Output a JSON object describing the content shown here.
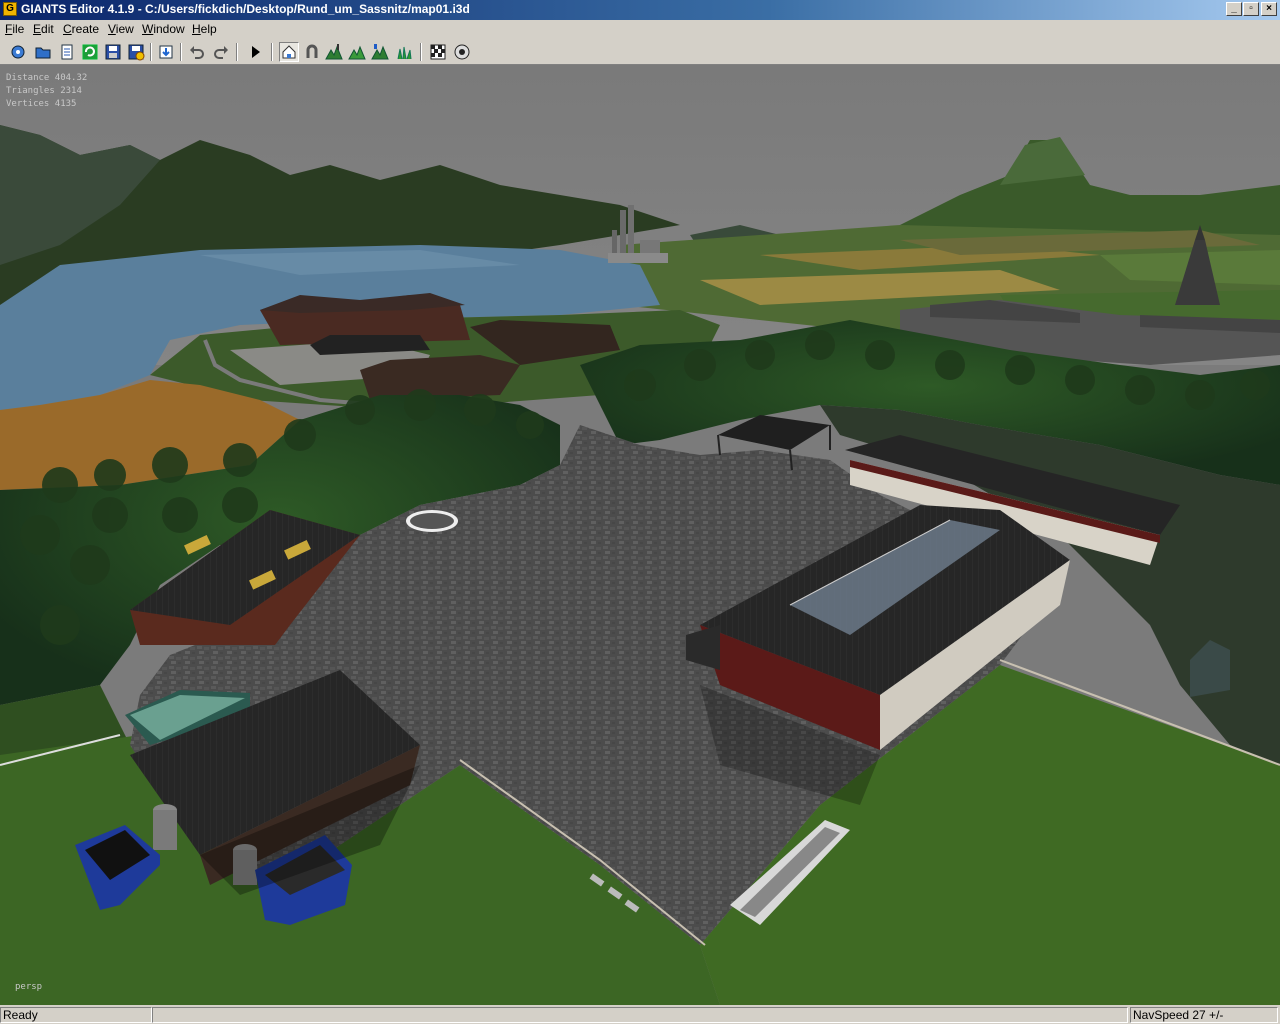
{
  "window": {
    "title": "GIANTS Editor 4.1.9 - C:/Users/fickdich/Desktop/Rund_um_Sassnitz/map01.i3d",
    "icon": "giants-editor-icon",
    "controls": [
      "minimize",
      "restore",
      "close"
    ]
  },
  "menu": [
    {
      "label": "File",
      "accel": "F"
    },
    {
      "label": "Edit",
      "accel": "E"
    },
    {
      "label": "Create",
      "accel": "C"
    },
    {
      "label": "View",
      "accel": "V"
    },
    {
      "label": "Window",
      "accel": "W"
    },
    {
      "label": "Help",
      "accel": "H"
    }
  ],
  "toolbar": {
    "groups": [
      [
        "new-scene-icon",
        "open-icon",
        "properties-icon",
        "refresh-icon",
        "save-icon",
        "save-as-icon"
      ],
      [
        "import-icon"
      ],
      [
        "undo-icon",
        "redo-icon"
      ],
      [
        "play-icon"
      ],
      [
        "select-mode-icon",
        "move-mode-icon",
        "terrain-paint-icon",
        "terrain-sculpt-icon",
        "foliage-paint-icon",
        "foliage-grass-icon"
      ],
      [
        "checkerboard-icon",
        "render-settings-icon"
      ]
    ],
    "active": "select-mode-icon"
  },
  "viewport": {
    "stats": [
      {
        "label": "Distance",
        "value": "404.32"
      },
      {
        "label": "Triangles",
        "value": "2314"
      },
      {
        "label": "Vertices",
        "value": "4135"
      }
    ],
    "camera": "persp",
    "colors": {
      "sky": "#7b7b7b",
      "grass": "#3f6a23",
      "forest": "#1e3a1a",
      "water": "#5a7f9c",
      "cobblestone": "#4a4a4a",
      "roof": "#262626",
      "barn_wall": "#5b1a18"
    }
  },
  "status": {
    "left": "Ready",
    "right": "NavSpeed 27 +/-"
  }
}
